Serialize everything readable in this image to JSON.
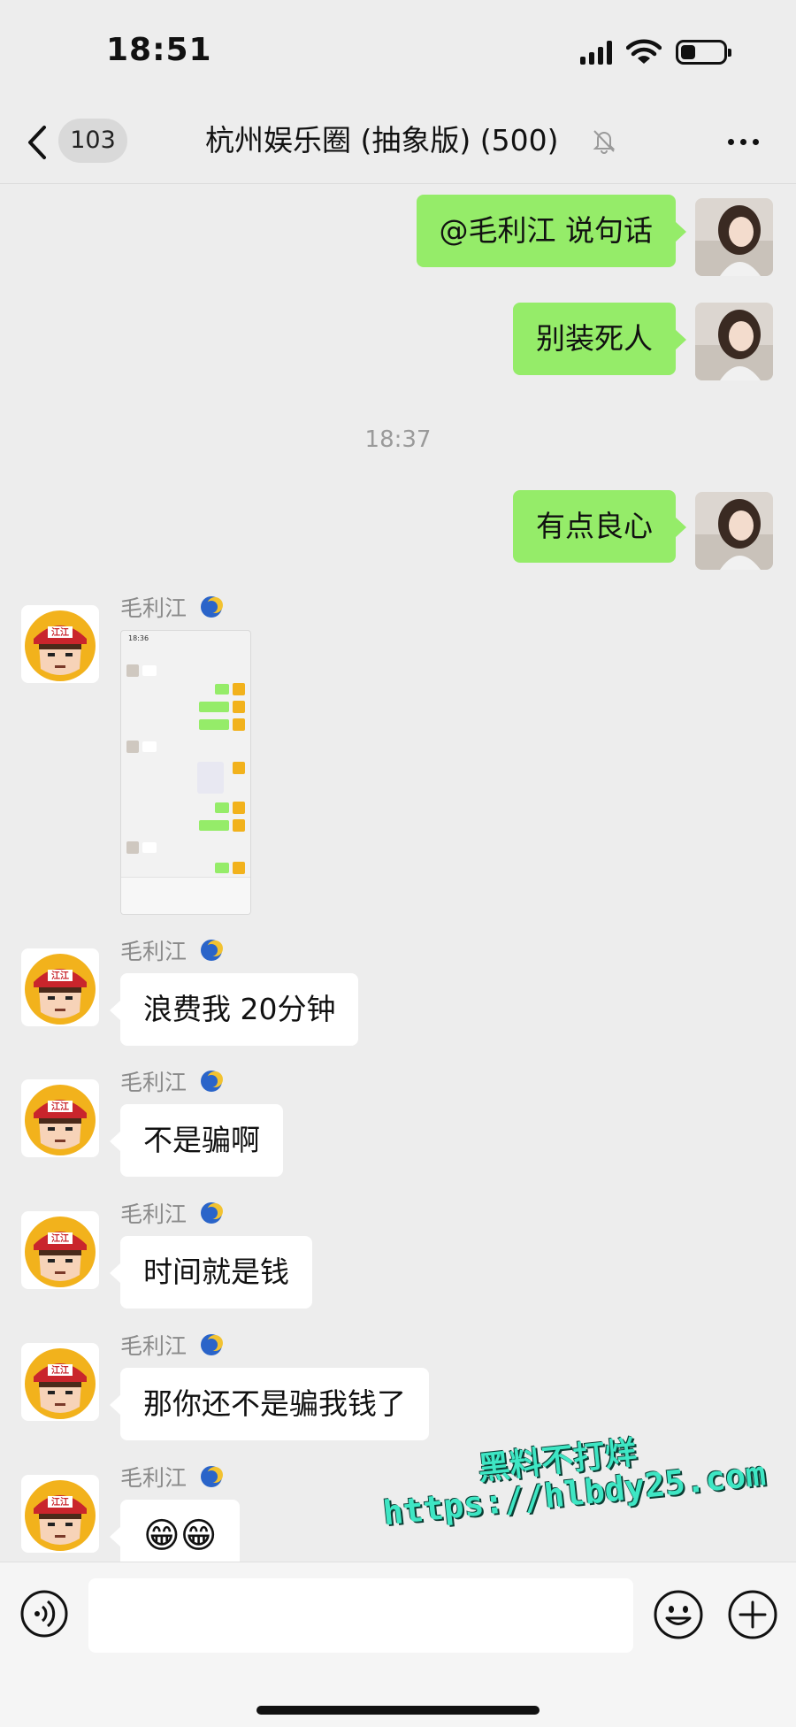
{
  "status_bar": {
    "time": "18:51"
  },
  "nav": {
    "unread_count": "103",
    "title": "杭州娱乐圈 (抽象版) (500)",
    "back_icon": "chevron-left-icon",
    "mute_icon": "bell-slash-icon",
    "more_icon": "ellipsis-icon"
  },
  "messages": [
    {
      "from": "me",
      "text": "@毛利江 说句话"
    },
    {
      "from": "me",
      "text": "别装死人"
    },
    {
      "type": "time",
      "text": "18:37"
    },
    {
      "from": "me",
      "text": "有点良心"
    },
    {
      "from": "other",
      "sender": "毛利江",
      "type": "image"
    },
    {
      "from": "other",
      "sender": "毛利江",
      "text": "浪费我 20分钟"
    },
    {
      "from": "other",
      "sender": "毛利江",
      "text": "不是骗啊"
    },
    {
      "from": "other",
      "sender": "毛利江",
      "text": "时间就是钱"
    },
    {
      "from": "other",
      "sender": "毛利江",
      "text": "那你还不是骗我钱了"
    },
    {
      "from": "other",
      "sender": "毛利江",
      "text": "😁😁"
    }
  ],
  "avatar_text": "江江",
  "shot": {
    "time": "18:36"
  },
  "watermark": {
    "line1": "黑料不打烊",
    "line2": "https://hlbdy25.com"
  },
  "input": {
    "value": ""
  },
  "colors": {
    "my_bubble": "#95ec69",
    "other_bubble": "#ffffff",
    "background": "#ededed"
  }
}
